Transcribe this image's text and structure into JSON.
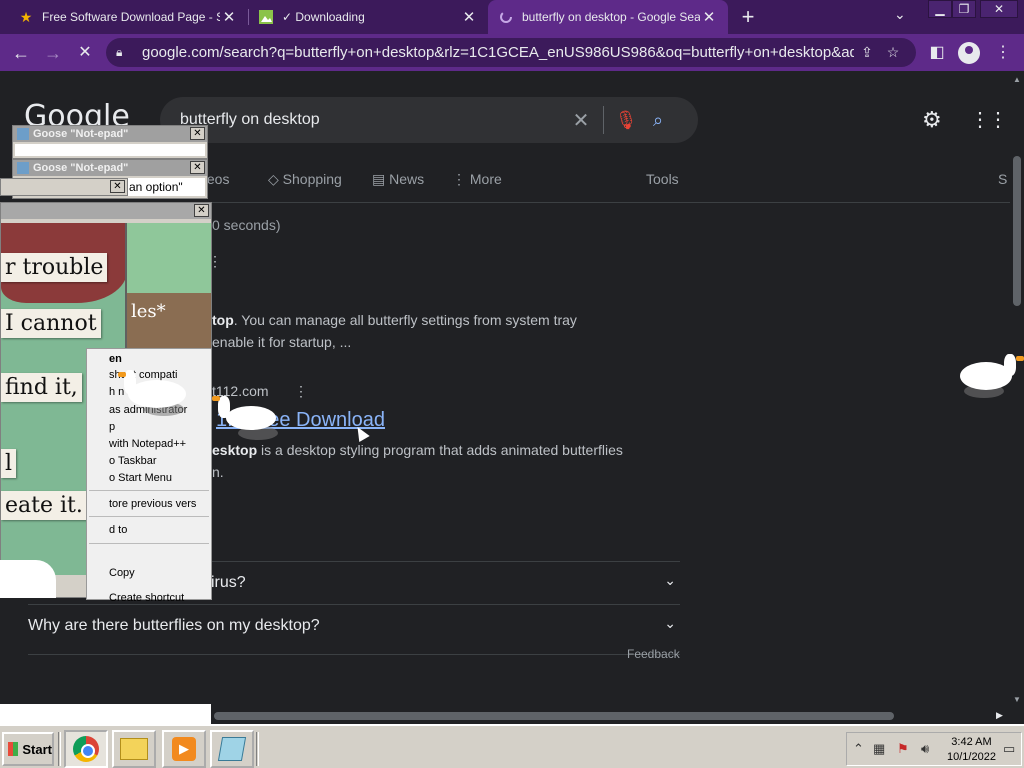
{
  "browser": {
    "tabs": [
      {
        "title": "Free Software Download Page - Sof",
        "icon": "star-icon"
      },
      {
        "title": "✓ Downloading",
        "icon": "image-icon"
      },
      {
        "title": "butterfly on desktop - Google Searc",
        "icon": "loading-icon"
      }
    ],
    "url": "google.com/search?q=butterfly+on+desktop&rlz=1C1GCEA_enUS986US986&oq=butterfly+on+desktop&aqs=c...",
    "window_controls": {
      "minimize": "▁",
      "maximize": "❐",
      "close": "✕"
    }
  },
  "google": {
    "logo": "Google",
    "query": "butterfly on desktop",
    "nav_tabs": {
      "videos": "ideos",
      "shopping": "Shopping",
      "news": "News",
      "more": "More",
      "tools": "Tools",
      "s": "S"
    },
    "stats": "0 seconds)",
    "snippet1_bold": "top",
    "snippet1_rest": ". You can manage all butterfly settings from system tray",
    "snippet1_line2": "enable it for startup, ...",
    "result_site": "t112.com",
    "result_title": "1.3 Free Download",
    "snippet2_bold": "esktop",
    "snippet2_rest": " is a desktop styling program that adds animated butterflies",
    "snippet2_line2": "n.",
    "paa": [
      {
        "question": "irus?"
      },
      {
        "question": "Why are there butterflies on my desktop?"
      }
    ],
    "feedback": "Feedback"
  },
  "goose": {
    "notepad_title": "Goose \"Not-epad\"",
    "notepad2_text": "an option\"",
    "meme_notes": [
      "r trouble",
      "I cannot",
      "find it,",
      "l",
      "eate it."
    ],
    "meme2_text": "les*",
    "context_menu": [
      "en",
      "shoot compati",
      "h        n",
      "as administrator",
      "p",
      "with Notepad++",
      "o Taskbar",
      "o Start Menu",
      "tore previous vers",
      "d to",
      "Copy",
      "Create shortcut"
    ]
  },
  "taskbar": {
    "start": "Start",
    "time": "3:42 AM",
    "date": "10/1/2022"
  }
}
